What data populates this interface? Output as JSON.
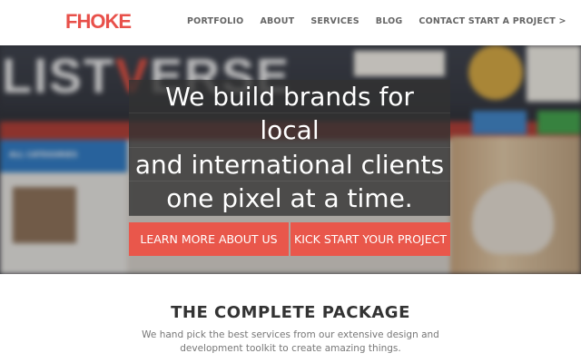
{
  "brand": {
    "logo_text": "FHOKE",
    "accent_color": "#e8504a"
  },
  "nav": {
    "items": [
      {
        "label": "PORTFOLIO"
      },
      {
        "label": "ABOUT"
      },
      {
        "label": "SERVICES"
      },
      {
        "label": "BLOG"
      },
      {
        "label": "CONTACT START A PROJECT >"
      }
    ]
  },
  "hero": {
    "headline_lines": [
      "We build brands for",
      "local",
      "and international clients",
      "one pixel at a time."
    ],
    "background": {
      "site_name": "LISTVERSE",
      "category_label": "ALL CATEGORIES"
    },
    "buttons": {
      "primary": "LEARN MORE ABOUT US",
      "secondary": "KICK START YOUR PROJECT"
    },
    "button_color": "#e9574b"
  },
  "section": {
    "title": "THE COMPLETE PACKAGE",
    "description": "We hand pick the best services from our extensive design and development toolkit to create amazing things."
  }
}
